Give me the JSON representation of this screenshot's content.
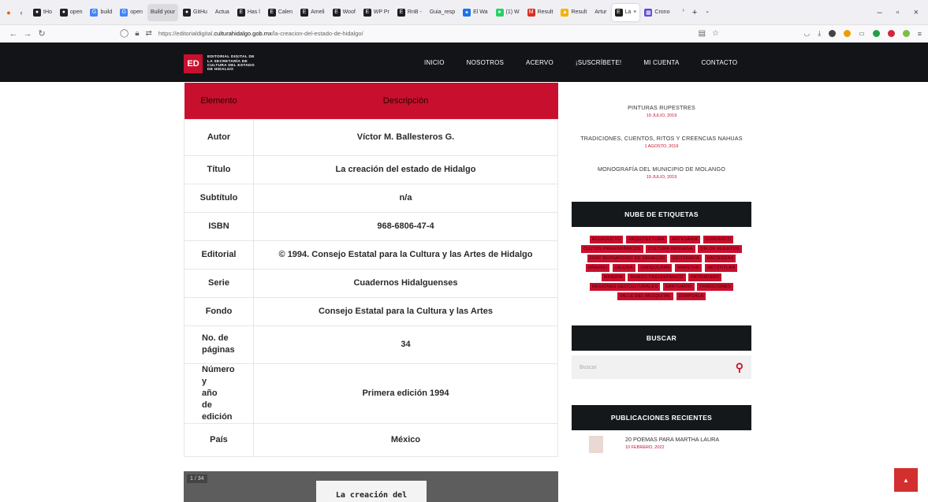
{
  "browser": {
    "tabs": [
      {
        "label": "tHo",
        "icon": "github-icon"
      },
      {
        "label": "open",
        "icon": "github-icon"
      },
      {
        "label": "build",
        "icon": "google-icon"
      },
      {
        "label": "open",
        "icon": "google-icon"
      },
      {
        "label": "Build your",
        "icon": "none"
      },
      {
        "label": "GitHu",
        "icon": "github-icon"
      },
      {
        "label": "Actua",
        "icon": "none"
      },
      {
        "label": "Has l",
        "icon": "site-icon"
      },
      {
        "label": "Calen",
        "icon": "site-icon"
      },
      {
        "label": "Ameli",
        "icon": "site-icon"
      },
      {
        "label": "Woof",
        "icon": "site-icon"
      },
      {
        "label": "WP Pr",
        "icon": "site-icon"
      },
      {
        "label": "RnB -",
        "icon": "site-icon"
      },
      {
        "label": "Guia_resp",
        "icon": "none"
      },
      {
        "label": "El Wa",
        "icon": "star-icon"
      },
      {
        "label": "(1) W",
        "icon": "whatsapp-icon"
      },
      {
        "label": "Result",
        "icon": "gmail-icon"
      },
      {
        "label": "Result",
        "icon": "drive-icon"
      },
      {
        "label": "Artur",
        "icon": "none"
      },
      {
        "label": "La",
        "icon": "site-icon"
      },
      {
        "label": "Crono",
        "icon": "calendar-icon"
      }
    ],
    "url_prefix": "https://editorialdigital.",
    "url_domain": "culturahidalgo.gob.mx",
    "url_path": "/la-creacion-del-estado-de-hidalgo/"
  },
  "site": {
    "logo_mark": "ED",
    "logo_lines": [
      "EDITORIAL DIGITAL DE",
      "LA SECRETARÍA DE",
      "CULTURA DEL ESTADO",
      "DE HIDALGO"
    ],
    "nav": [
      "INICIO",
      "NOSOTROS",
      "ACERVO",
      "¡SUSCRÍBETE!",
      "MI CUENTA",
      "CONTACTO"
    ]
  },
  "table": {
    "headers": [
      "Elemento",
      "Descripción"
    ],
    "rows": [
      {
        "label": "Autor",
        "value": "Víctor M. Ballesteros G."
      },
      {
        "label": "Título",
        "value": "La creación del estado de Hidalgo"
      },
      {
        "label": "Subtítulo",
        "value": "n/a"
      },
      {
        "label": "ISBN",
        "value": "968-6806-47-4"
      },
      {
        "label": "Editorial",
        "value": "© 1994. Consejo Estatal para la Cultura y las Artes de Hidalgo"
      },
      {
        "label": "Serie",
        "value": "Cuadernos Hidalguenses"
      },
      {
        "label": "Fondo",
        "value": "Consejo Estatal para la Cultura y las Artes"
      },
      {
        "label": "No. de páginas",
        "value": "34"
      },
      {
        "label": "Número y año de edición",
        "value": "Primera edición 1994"
      },
      {
        "label": "País",
        "value": "México"
      }
    ]
  },
  "viewer": {
    "page_indicator": "1 / 34",
    "cover_text": "La creación del"
  },
  "sidebar": {
    "posts": [
      {
        "title": "PINTURAS RUPESTRES",
        "date": "19 JULIO, 2019"
      },
      {
        "title": "TRADICIONES, CUENTOS, RITOS Y CREENCIAS NAHUAS",
        "date": "1 AGOSTO, 2019"
      },
      {
        "title": "MONOGRAFÍA DEL MUNICIPIO DE MOLANGO",
        "date": "19 JULIO, 2019"
      }
    ],
    "tags_title": "NUBE DE ETIQUETAS",
    "tags": [
      "ACUEDUCTO",
      "ARQUITECTURA",
      "ARTESANÍA",
      "CONVENTO",
      "CULTOS PREHISPÁNICOS",
      "CULTURA INDÍGENA",
      "DÍA DE MUERTOS",
      "FRAY BERNARDINO DE SAHAGÚN",
      "GEOGRAFÍA",
      "HACIENDAS",
      "HÑAHNU",
      "IGLESIA",
      "IXMIQUILPAN",
      "MAPETHE",
      "METZTITLÁN",
      "MINERÍA",
      "MUNDO PREHISPÁNICO",
      "PATRIMONIO",
      "REGIONES GEOCULTURALES",
      "SANTUARIO",
      "TRADICIONES",
      "VALLE DEL MEZQUITAL",
      "ZEMPOALA"
    ],
    "search_title": "BUSCAR",
    "search_placeholder": "Buscar",
    "recent_title": "PUBLICACIONES RECIENTES",
    "recent": [
      {
        "title": "20 POEMAS PARA MARTHA LAURA",
        "date": "10 FEBRERO, 2022"
      }
    ]
  },
  "colors": {
    "accent": "#c8102e",
    "header_bg": "#121417"
  }
}
